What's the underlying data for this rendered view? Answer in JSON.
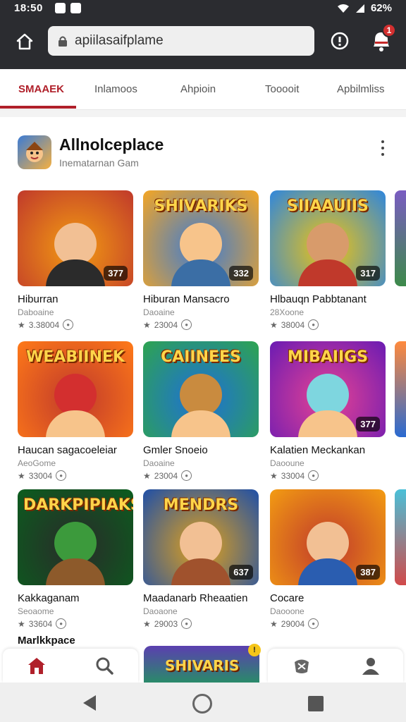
{
  "status": {
    "time": "18:50",
    "battery": "62%"
  },
  "search": {
    "value": "apiilasaifplame"
  },
  "notifications": {
    "count": "1"
  },
  "tabs": [
    {
      "label": "SMAAEK"
    },
    {
      "label": "Inlamoos"
    },
    {
      "label": "Ahpioin"
    },
    {
      "label": "Tooooit"
    },
    {
      "label": "Apbilmliss"
    }
  ],
  "section": {
    "title": "Allnolceplace",
    "subtitle": "Inematarnan Gam"
  },
  "games": [
    {
      "name": "Hiburran",
      "category": "Daboaine",
      "downloads": "3.38004",
      "rating": "377",
      "art_title": ""
    },
    {
      "name": "Hiburan Mansacro",
      "category": "Daoaine",
      "downloads": "23004",
      "rating": "332",
      "art_title": "SHIVARIKS"
    },
    {
      "name": "Hlbauqn Pabbtanant",
      "category": "28Xoone",
      "downloads": "38004",
      "rating": "317",
      "art_title": "SIIAAUIIS"
    },
    {
      "name": "Haucan sagacoeleiar",
      "category": "AeoGome",
      "downloads": "33004",
      "rating": "",
      "art_title": "WEABIINEK"
    },
    {
      "name": "Gmler Snoeio",
      "category": "Daoaine",
      "downloads": "23004",
      "rating": "",
      "art_title": "CAIINEES"
    },
    {
      "name": "Kalatien Meckankan",
      "category": "Daooune",
      "downloads": "33004",
      "rating": "377",
      "art_title": "MIBAIIGS"
    },
    {
      "name": "Kakkaganam",
      "category": "Seoaome",
      "downloads": "33604",
      "rating": "",
      "art_title": "DARKPIPIAKS"
    },
    {
      "name": "Maadanarb Rheaatien",
      "category": "Daoaone",
      "downloads": "29003",
      "rating": "637",
      "art_title": "MENDRS"
    },
    {
      "name": "Cocare",
      "category": "Daooone",
      "downloads": "29004",
      "rating": "387",
      "art_title": ""
    }
  ],
  "peek": {
    "label": "Marlkkpace",
    "art_title": "SHIVARIS",
    "badge": "!"
  },
  "colors": {
    "accent": "#b0202a",
    "topbar": "#2b2c30"
  },
  "icons": [
    "home-icon",
    "search-icon",
    "gamepad-icon",
    "profile-icon",
    "lock-icon",
    "bell-icon",
    "alert-icon",
    "more-vert-icon"
  ]
}
